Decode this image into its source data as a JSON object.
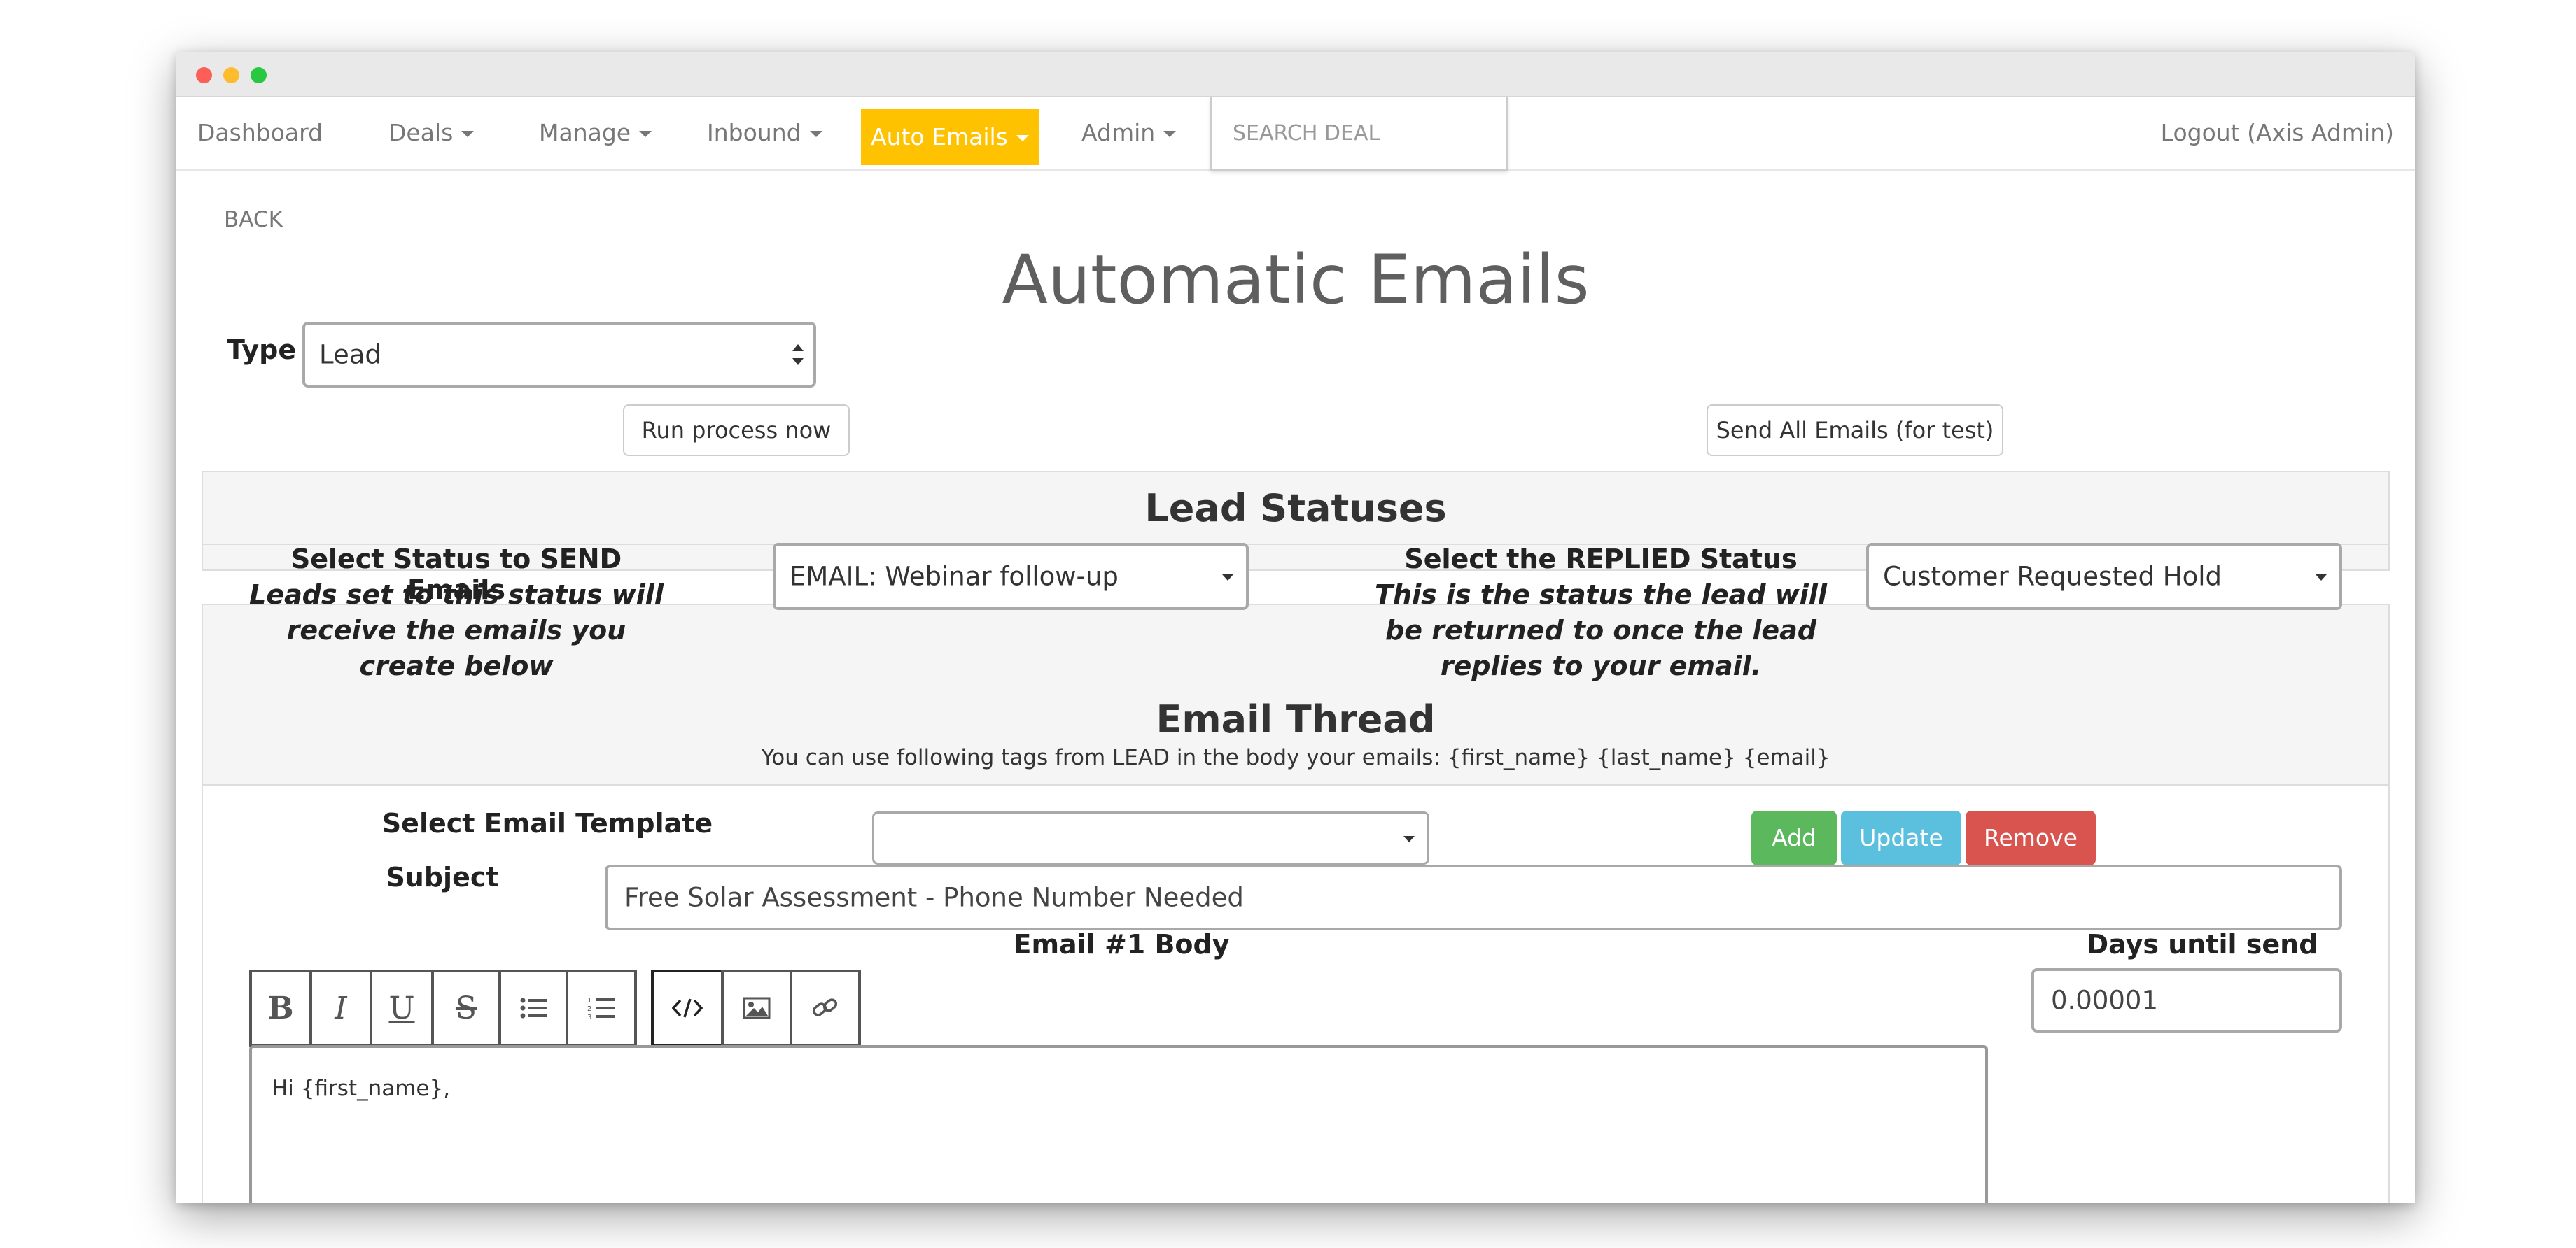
{
  "nav": {
    "items": [
      {
        "label": "Dashboard",
        "has_caret": false
      },
      {
        "label": "Deals",
        "has_caret": true
      },
      {
        "label": "Manage",
        "has_caret": true
      },
      {
        "label": "Inbound",
        "has_caret": true
      },
      {
        "label": "Auto Emails",
        "has_caret": true,
        "active": true
      },
      {
        "label": "Admin",
        "has_caret": true
      }
    ],
    "search_placeholder": "SEARCH DEAL",
    "logout_label": "Logout (Axis Admin)",
    "active_color": "#fec200"
  },
  "page": {
    "back_label": "BACK",
    "title": "Automatic Emails",
    "type_label": "Type",
    "type_value": "Lead",
    "run_process_label": "Run process now",
    "send_all_label": "Send All Emails (for test)"
  },
  "statuses": {
    "heading": "Lead Statuses",
    "send_label": "Select Status to SEND Emails",
    "send_note": "Leads set to this status will receive the emails you create below",
    "send_value": "EMAIL: Webinar follow-up",
    "replied_label": "Select the REPLIED Status",
    "replied_note": "This is the status the lead will be returned to once the lead replies to your email.",
    "replied_value": "Customer Requested Hold"
  },
  "thread": {
    "heading": "Email Thread",
    "tags_note": "You can use following tags from LEAD in the body your emails: {first_name} {last_name} {email}",
    "template_label": "Select Email Template",
    "template_value": "",
    "add_label": "Add",
    "update_label": "Update",
    "remove_label": "Remove",
    "subject_label": "Subject",
    "subject_value": "Free Solar Assessment - Phone Number Needed",
    "body_label": "Email #1 Body",
    "days_label": "Days until send",
    "days_value": "0.00001",
    "body_text": "Hi {first_name},",
    "colors": {
      "add": "#5cb85c",
      "update": "#5bc0de",
      "remove": "#d9534f"
    }
  },
  "toolbar": [
    "bold-icon",
    "italic-icon",
    "underline-icon",
    "strikethrough-icon",
    "bullet-list-icon",
    "numbered-list-icon",
    "code-view-icon",
    "image-icon",
    "link-icon"
  ]
}
